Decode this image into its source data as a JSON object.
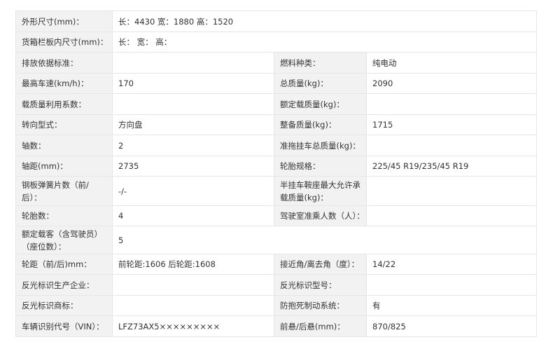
{
  "rows": [
    {
      "label": "外形尺寸(mm)：",
      "value": "长：4430 宽：1880 高：1520"
    },
    {
      "label": "货箱栏板内尺寸(mm)：",
      "value": "长： 宽： 高："
    },
    {
      "label": "排放依据标准：",
      "value": "",
      "label2": "燃料种类：",
      "value2": "纯电动"
    },
    {
      "label": "最高车速(km/h)：",
      "value": "170",
      "label2": "总质量(kg)：",
      "value2": "2090"
    },
    {
      "label": "载质量利用系数：",
      "value": "",
      "label2": "额定载质量(kg)：",
      "value2": ""
    },
    {
      "label": "转向型式：",
      "value": "方向盘",
      "label2": "整备质量(kg)：",
      "value2": "1715"
    },
    {
      "label": "轴数：",
      "value": "2",
      "label2": "准拖挂车总质量(kg)：",
      "value2": ""
    },
    {
      "label": "轴距(mm)：",
      "value": "2735",
      "label2": "轮胎规格：",
      "value2": "225/45 R19/235/45 R19"
    },
    {
      "label": "钢板弹簧片数（前/后）：",
      "value": "-/-",
      "label2": "半挂车鞍座最大允许承载质量(kg)：",
      "value2": ""
    },
    {
      "label": "轮胎数：",
      "value": "4",
      "label2": "驾驶室准乘人数（人）：",
      "value2": ""
    },
    {
      "label": "额定载客（含驾驶员）（座位数）：",
      "value": "5"
    },
    {
      "label": "轮距（前/后)mm：",
      "value": "前轮距:1606 后轮距:1608",
      "label2": "接近角/离去角（度）：",
      "value2": "14/22"
    },
    {
      "label": "反光标识生产企业：",
      "value": "",
      "label2": "反光标识型号：",
      "value2": ""
    },
    {
      "label": "反光标识商标：",
      "value": "",
      "label2": "防抱死制动系统：",
      "value2": "有"
    },
    {
      "label": "车辆识别代号（VIN）：",
      "value": "LFZ73AX5×××××××××",
      "label2": "前悬/后悬(mm)：",
      "value2": "870/825"
    }
  ]
}
